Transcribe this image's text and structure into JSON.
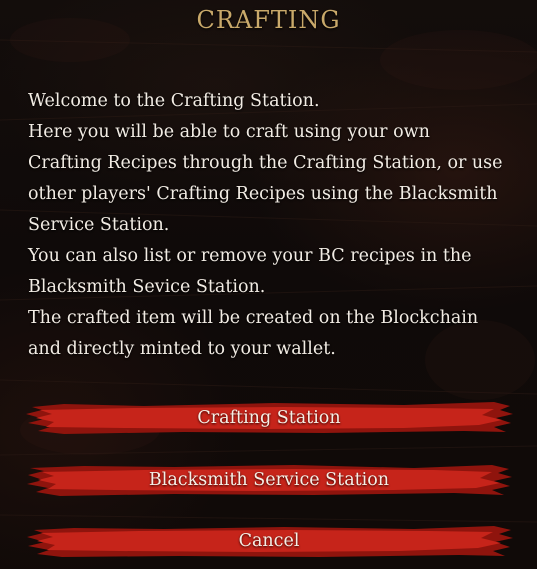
{
  "dialog": {
    "title": "CRAFTING",
    "lines": [
      "Welcome to the Crafting Station.",
      "Here you will be able to craft using your own",
      "Crafting Recipes through the Crafting Station, or use",
      "other players' Crafting Recipes using the Blacksmith",
      "Service Station.",
      "You can also list or remove your BC recipes in the",
      "Blacksmith Sevice Station.",
      "The crafted item will be created on the Blockchain",
      "and directly minted to your wallet."
    ]
  },
  "buttons": {
    "crafting_station": "Crafting Station",
    "blacksmith_service_station": "Blacksmith Service Station",
    "cancel": "Cancel"
  },
  "colors": {
    "title": "#c9a96a",
    "text": "#f2ece4",
    "button_red": "#c6241a",
    "button_dark_red": "#8f140d",
    "background": "#110b09"
  }
}
